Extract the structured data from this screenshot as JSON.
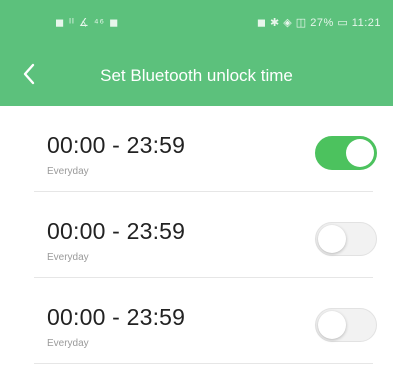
{
  "status_bar": {
    "left": "◼ ᴵᴵ ∡ ⁴⁶ ◼",
    "right": "◼ ✱ ◈ ◫ 27% ▭ 11:21"
  },
  "header": {
    "title": "Set Bluetooth unlock time",
    "back_icon": "chevron-left-icon",
    "color": "#5cc17c"
  },
  "items": [
    {
      "time": "00:00 - 23:59",
      "repeat": "Everyday",
      "enabled": true
    },
    {
      "time": "00:00 - 23:59",
      "repeat": "Everyday",
      "enabled": false
    },
    {
      "time": "00:00 - 23:59",
      "repeat": "Everyday",
      "enabled": false
    }
  ]
}
